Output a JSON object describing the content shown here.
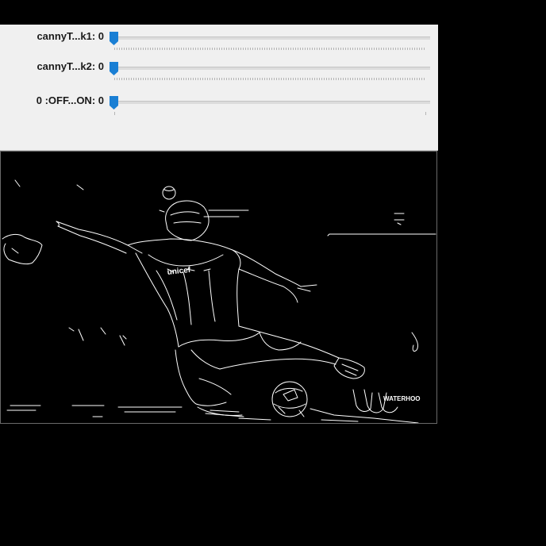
{
  "window": {
    "trackbars": [
      {
        "label": "cannyT...k1: 0",
        "value": 0
      },
      {
        "label": "cannyT...k2: 0",
        "value": 0
      },
      {
        "label": "0 :OFF...ON: 0",
        "value": 0
      }
    ]
  },
  "image": {
    "description_icon": "canny-edge-output-image",
    "jersey_text": "unicef",
    "board_text": "WATERHOO"
  },
  "colors": {
    "panel_bg": "#f0f0f0",
    "thumb": "#1a7fd4",
    "edges": "#ffffff",
    "canvas_bg": "#000000"
  }
}
